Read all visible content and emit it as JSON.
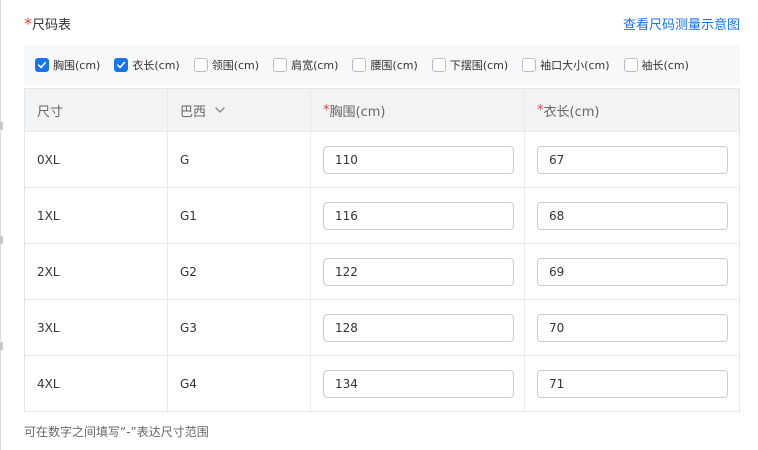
{
  "header": {
    "required_mark": "*",
    "title": "尺码表",
    "guide_link": "查看尺码测量示意图"
  },
  "options": [
    {
      "label": "胸围(cm)",
      "checked": true
    },
    {
      "label": "衣长(cm)",
      "checked": true
    },
    {
      "label": "领围(cm)",
      "checked": false
    },
    {
      "label": "肩宽(cm)",
      "checked": false
    },
    {
      "label": "腰围(cm)",
      "checked": false
    },
    {
      "label": "下摆围(cm)",
      "checked": false
    },
    {
      "label": "袖口大小(cm)",
      "checked": false
    },
    {
      "label": "袖长(cm)",
      "checked": false
    }
  ],
  "table": {
    "columns": {
      "size": "尺寸",
      "region": "巴西",
      "chest": "胸围(cm)",
      "length": "衣长(cm)",
      "required_mark": "*"
    },
    "rows": [
      {
        "size": "0XL",
        "region": "G",
        "chest": "110",
        "length": "67"
      },
      {
        "size": "1XL",
        "region": "G1",
        "chest": "116",
        "length": "68"
      },
      {
        "size": "2XL",
        "region": "G2",
        "chest": "122",
        "length": "69"
      },
      {
        "size": "3XL",
        "region": "G3",
        "chest": "128",
        "length": "70"
      },
      {
        "size": "4XL",
        "region": "G4",
        "chest": "134",
        "length": "71"
      }
    ]
  },
  "hint": "可在数字之间填写“-”表达尺寸范围",
  "colors": {
    "accent": "#1a73e8",
    "required": "#e8483c",
    "header_bg": "#f2f3f5",
    "option_bg": "#f7f8fa"
  }
}
